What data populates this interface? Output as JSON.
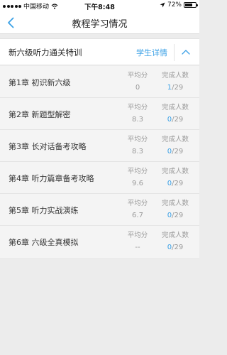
{
  "status_bar": {
    "carrier": "中国移动",
    "time": "下午8:48",
    "battery": "72%",
    "battery_level": 0.72
  },
  "nav": {
    "title": "教程学习情况",
    "back_icon": "chevron-left-icon"
  },
  "course": {
    "name": "新六级听力通关特训",
    "detail_link": "学生详情",
    "collapse_icon": "chevron-up-icon"
  },
  "stat_labels": {
    "average": "平均分",
    "completed": "完成人数"
  },
  "chapters": [
    {
      "name": "第1章  初识新六级",
      "average": "0",
      "done": "1",
      "total": "/29"
    },
    {
      "name": "第2章  新题型解密",
      "average": "8.3",
      "done": "0",
      "total": "/29"
    },
    {
      "name": "第3章  长对话备考攻略",
      "average": "8.3",
      "done": "0",
      "total": "/29"
    },
    {
      "name": "第4章  听力篇章备考攻略",
      "average": "9.6",
      "done": "0",
      "total": "/29"
    },
    {
      "name": "第5章  听力实战演练",
      "average": "6.7",
      "done": "0",
      "total": "/29"
    },
    {
      "name": "第6章  六级全真模拟",
      "average": "--",
      "done": "0",
      "total": "/29"
    }
  ],
  "colors": {
    "accent": "#3aa0e6",
    "background": "#ececec"
  }
}
